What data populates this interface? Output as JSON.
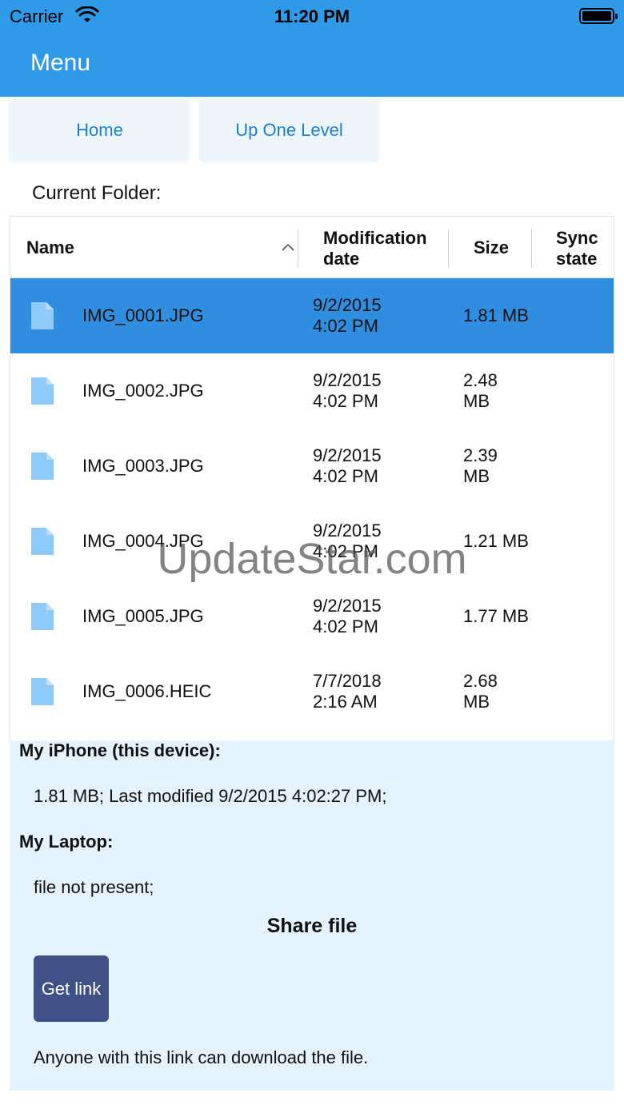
{
  "status_bar": {
    "carrier": "Carrier",
    "time": "11:20 PM"
  },
  "nav": {
    "title": "Menu"
  },
  "buttons": {
    "home": "Home",
    "up_one_level": "Up One Level"
  },
  "current_folder_label": "Current Folder:",
  "grid": {
    "headers": {
      "name": "Name",
      "modification_date_line1": "Modification",
      "modification_date_line2": "date",
      "size": "Size",
      "sync_state_line1": "Sync",
      "sync_state_line2": "state"
    },
    "rows": [
      {
        "name": "IMG_0001.JPG",
        "date": "9/2/2015",
        "time": "4:02 PM",
        "size_line1": "1.81 MB",
        "size_line2": ""
      },
      {
        "name": "IMG_0002.JPG",
        "date": "9/2/2015",
        "time": "4:02 PM",
        "size_line1": "2.48",
        "size_line2": "MB"
      },
      {
        "name": "IMG_0003.JPG",
        "date": "9/2/2015",
        "time": "4:02 PM",
        "size_line1": "2.39",
        "size_line2": "MB"
      },
      {
        "name": "IMG_0004.JPG",
        "date": "9/2/2015",
        "time": "4:02 PM",
        "size_line1": "1.21 MB",
        "size_line2": ""
      },
      {
        "name": "IMG_0005.JPG",
        "date": "9/2/2015",
        "time": "4:02 PM",
        "size_line1": "1.77 MB",
        "size_line2": ""
      },
      {
        "name": "IMG_0006.HEIC",
        "date": "7/7/2018",
        "time": "2:16 AM",
        "size_line1": "2.68",
        "size_line2": "MB"
      }
    ]
  },
  "details": {
    "device_label": "My iPhone (this device):",
    "device_info": "1.81 MB; Last modified 9/2/2015 4:02:27 PM;",
    "laptop_label": "My Laptop:",
    "laptop_info": "file not present;",
    "share_title": "Share file",
    "get_link": "Get link",
    "share_note": "Anyone with this link can download the file."
  },
  "watermark": "UpdateStar.com",
  "colors": {
    "accent": "#2f9be8",
    "selected_row": "#2f8ee0",
    "details_bg": "#e3f2fd",
    "get_link_bg": "#3f5186",
    "file_icon": "#90caf9"
  }
}
